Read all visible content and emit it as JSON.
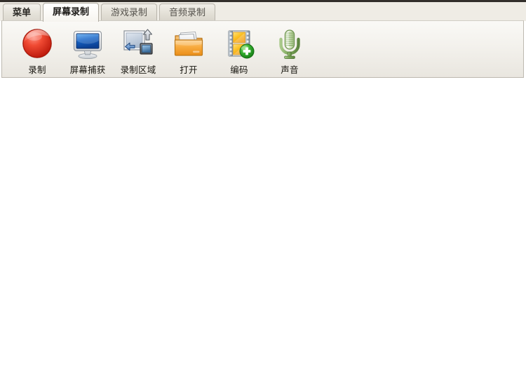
{
  "window": {
    "tabs": [
      {
        "id": "menu",
        "label": "菜单",
        "state": "menu"
      },
      {
        "id": "screen-record",
        "label": "屏幕录制",
        "state": "active"
      },
      {
        "id": "game-record",
        "label": "游戏录制",
        "state": "inactive"
      },
      {
        "id": "audio-record",
        "label": "音频录制",
        "state": "inactive"
      }
    ]
  },
  "toolbar": {
    "buttons": [
      {
        "id": "record",
        "label": "录制",
        "icon": "red-record-sphere-icon"
      },
      {
        "id": "screen-capture",
        "label": "屏幕捕获",
        "icon": "monitor-icon"
      },
      {
        "id": "record-area",
        "label": "录制区域",
        "icon": "selection-region-icon"
      },
      {
        "id": "open",
        "label": "打开",
        "icon": "open-folder-icon"
      },
      {
        "id": "encode",
        "label": "编码",
        "icon": "film-strip-plus-icon"
      },
      {
        "id": "sound",
        "label": "声音",
        "icon": "microphone-icon"
      }
    ]
  },
  "colors": {
    "top_strip": "#332f2b",
    "tabbar_bg": "#efece5",
    "ribbon_bg": "#f3f1ec",
    "ribbon_border": "#bdb9b0",
    "content_bg": "#ffffff",
    "record_red": "#e02b18",
    "monitor_blue": "#1f74d4",
    "folder_orange": "#f0a030",
    "encode_yellow": "#f8c020",
    "plus_green": "#2faa2f",
    "mic_green": "#7aab52",
    "text": "#17150f"
  }
}
